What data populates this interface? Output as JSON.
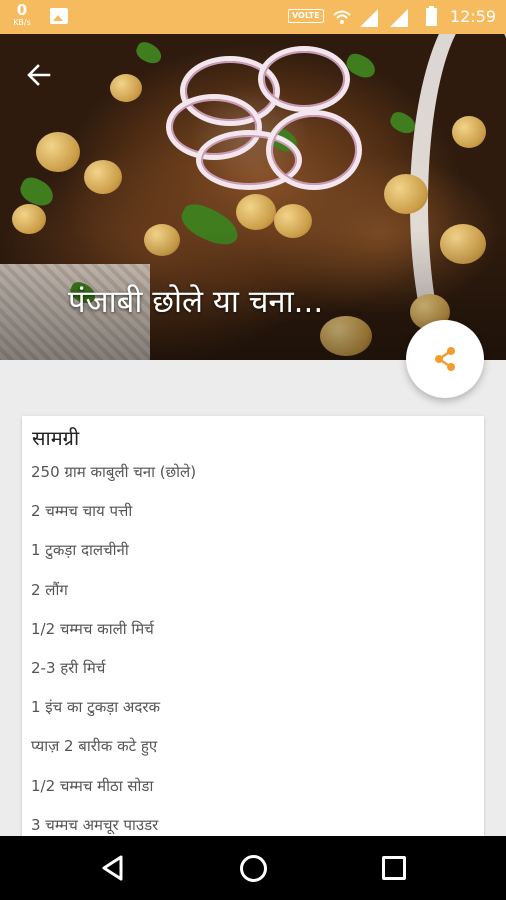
{
  "status_bar": {
    "net_speed_value": "0",
    "net_speed_unit": "KB/s",
    "volte_label": "VOLTE",
    "time": "12:59"
  },
  "icons": {
    "back": "arrow-left-icon",
    "share": "share-icon",
    "nav_back": "triangle-back-icon",
    "nav_home": "circle-home-icon",
    "nav_recent": "square-recents-icon"
  },
  "colors": {
    "status_bar": "#f6bb5e",
    "accent": "#f39c2b",
    "card_bg": "#ffffff",
    "page_bg": "#ececec"
  },
  "recipe": {
    "title": "पंजाबी छोले या चना...",
    "section_title": "सामग्री",
    "ingredients": [
      "250 ग्राम काबुली चना (छोले)",
      "2 चम्मच चाय पत्ती",
      "1 टुकड़ा दालचीनी",
      "2 लौंग",
      "1/2 चम्मच काली मिर्च",
      "2-3 हरी मिर्च",
      "1 इंच का टुकड़ा अदरक",
      "प्याज़ 2 बारीक कटे हुए",
      "1/2 चम्मच मीठा सोडा",
      "3 चम्मच अमचूर पाउडर"
    ]
  }
}
